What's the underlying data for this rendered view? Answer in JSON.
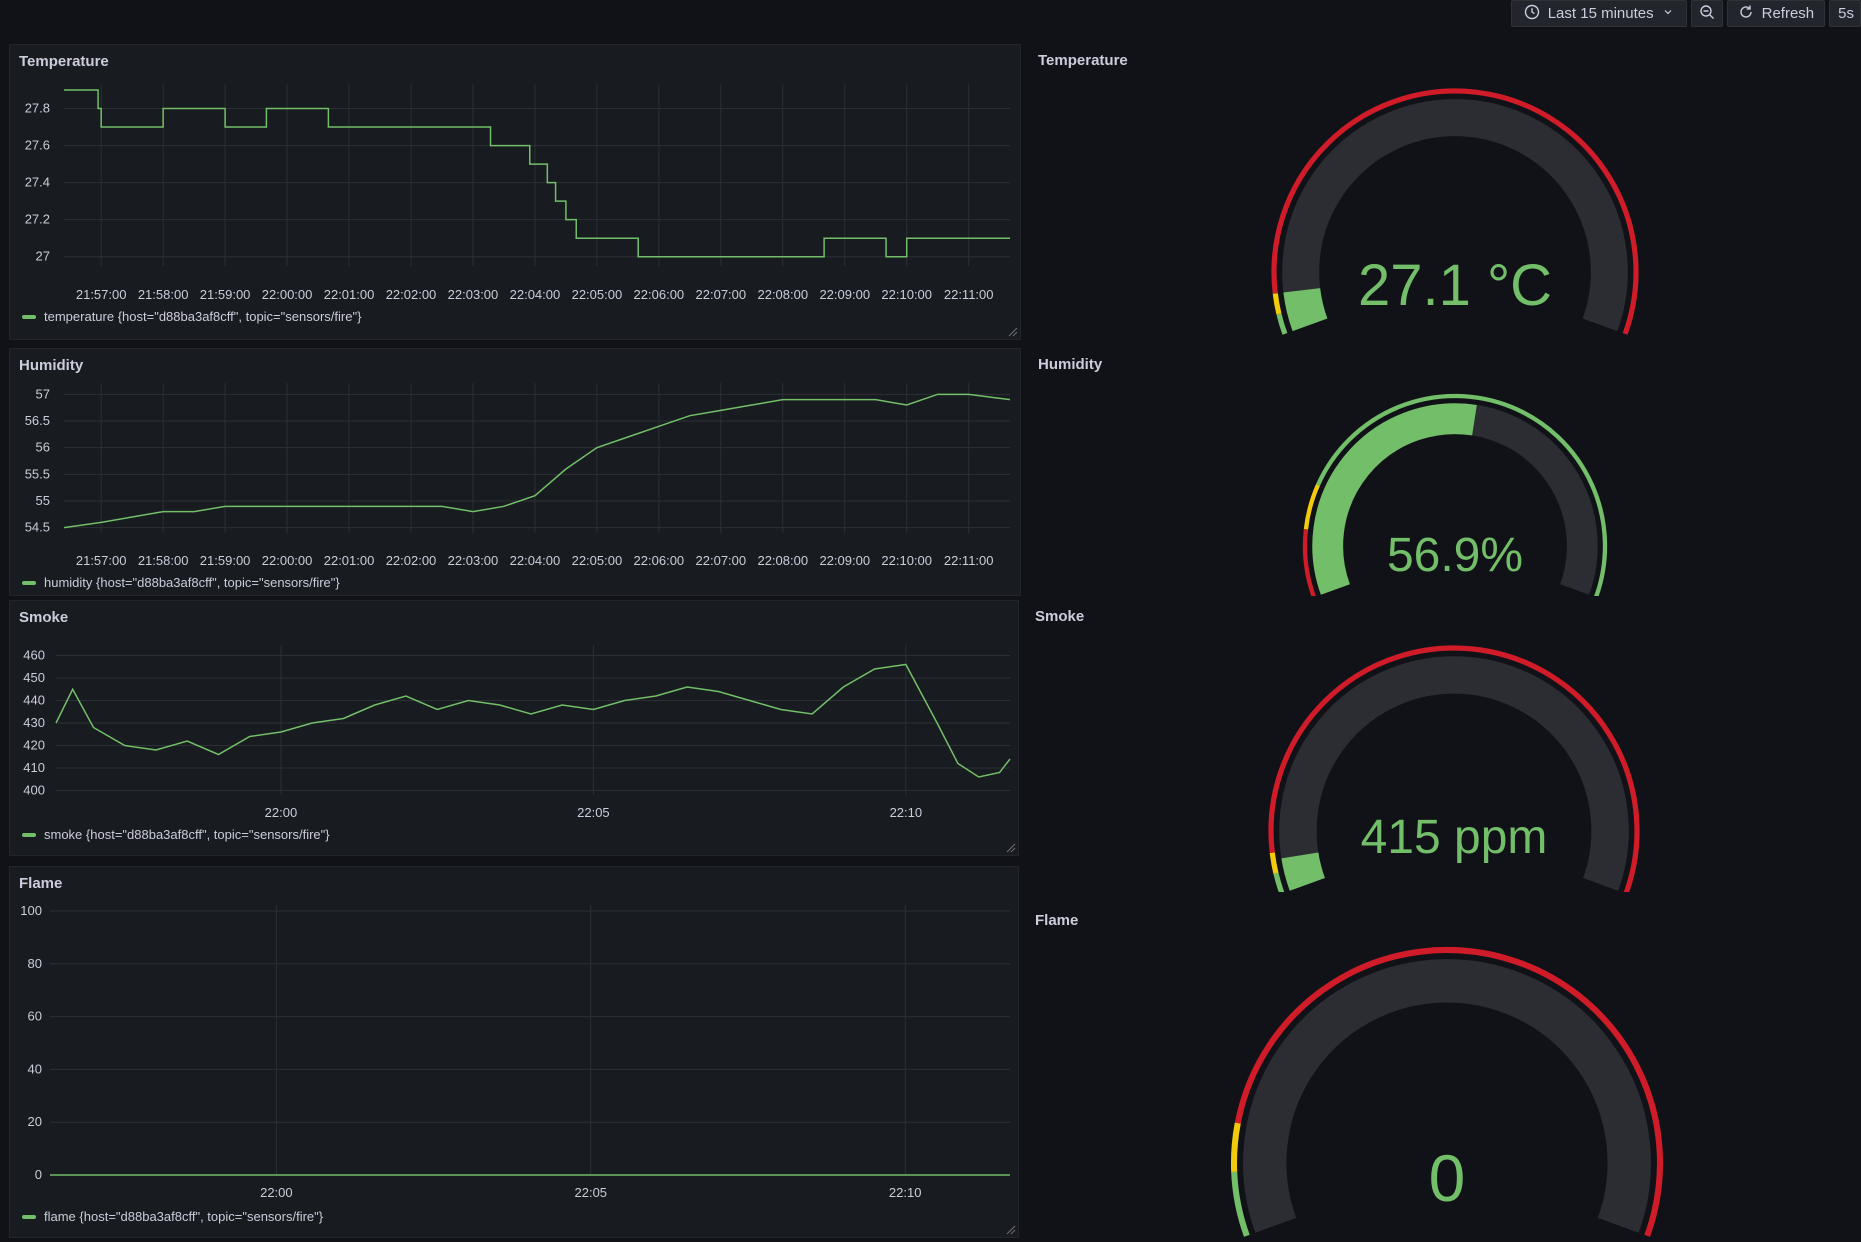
{
  "toolbar": {
    "time_range_label": "Last 15 minutes",
    "refresh_label": "Refresh",
    "refresh_interval": "5s",
    "icons": [
      "clock-icon",
      "chevron-down-icon",
      "zoom-out-icon",
      "refresh-icon"
    ]
  },
  "colors": {
    "series": "#73bf69",
    "threshold_red": "#d01c29",
    "threshold_yellow": "#f2cc0c",
    "threshold_green": "#73bf69",
    "gauge_track": "#2b2d33",
    "background": "#111217",
    "panel": "#181b1f"
  },
  "panels": {
    "temperature": {
      "title": "Temperature",
      "legend": "temperature {host=\"d88ba3af8cff\", topic=\"sensors/fire\"}"
    },
    "humidity": {
      "title": "Humidity",
      "legend": "humidity {host=\"d88ba3af8cff\", topic=\"sensors/fire\"}"
    },
    "smoke": {
      "title": "Smoke",
      "legend": "smoke {host=\"d88ba3af8cff\", topic=\"sensors/fire\"}"
    },
    "flame": {
      "title": "Flame",
      "legend": "flame {host=\"d88ba3af8cff\", topic=\"sensors/fire\"}"
    }
  },
  "gauges": {
    "temperature": {
      "title": "Temperature",
      "display": "27.1 °C",
      "fill_fraction": 0.06
    },
    "humidity": {
      "title": "Humidity",
      "display": "56.9%",
      "fill_fraction": 0.54
    },
    "smoke": {
      "title": "Smoke",
      "display": "415 ppm",
      "fill_fraction": 0.05
    },
    "flame": {
      "title": "Flame",
      "display": "0",
      "fill_fraction": 0.0
    }
  },
  "chart_data": [
    {
      "id": "temperature",
      "type": "line",
      "title": "Temperature",
      "x_ticks": [
        "21:57:00",
        "21:58:00",
        "21:59:00",
        "22:00:00",
        "22:01:00",
        "22:02:00",
        "22:03:00",
        "22:04:00",
        "22:05:00",
        "22:06:00",
        "22:07:00",
        "22:08:00",
        "22:09:00",
        "22:10:00",
        "22:11:00"
      ],
      "x_range": [
        "21:56:24",
        "22:11:40"
      ],
      "y_ticks": [
        "27",
        "27.2",
        "27.4",
        "27.6",
        "27.8"
      ],
      "ylim": [
        26.95,
        27.9
      ],
      "grid": true,
      "legend_position": "bottom-left",
      "series": [
        {
          "name": "temperature {host=\"d88ba3af8cff\", topic=\"sensors/fire\"}",
          "step": true,
          "x": [
            "21:56:24",
            "21:56:57",
            "21:57:00",
            "21:57:35",
            "21:58:00",
            "21:58:36",
            "21:59:00",
            "21:59:40",
            "22:00:00",
            "22:00:40",
            "22:01:00",
            "22:01:52",
            "22:02:00",
            "22:02:40",
            "22:03:00",
            "22:03:17",
            "22:03:40",
            "22:03:55",
            "22:04:12",
            "22:04:20",
            "22:04:30",
            "22:04:40",
            "22:04:52",
            "22:05:00",
            "22:05:40",
            "22:06:00",
            "22:06:40",
            "22:07:00",
            "22:07:40",
            "22:08:00",
            "22:08:40",
            "22:09:00",
            "22:09:40",
            "22:10:00",
            "22:10:20",
            "22:11:40"
          ],
          "y": [
            27.9,
            27.8,
            27.7,
            27.7,
            27.8,
            27.8,
            27.7,
            27.8,
            27.8,
            27.7,
            27.7,
            27.7,
            27.7,
            27.7,
            27.7,
            27.6,
            27.6,
            27.5,
            27.4,
            27.3,
            27.2,
            27.1,
            27.1,
            27.1,
            27.0,
            27.0,
            27.0,
            27.0,
            27.0,
            27.0,
            27.1,
            27.1,
            27.0,
            27.1,
            27.1,
            27.1
          ]
        }
      ]
    },
    {
      "id": "humidity",
      "type": "line",
      "title": "Humidity",
      "x_ticks": [
        "21:57:00",
        "21:58:00",
        "21:59:00",
        "22:00:00",
        "22:01:00",
        "22:02:00",
        "22:03:00",
        "22:04:00",
        "22:05:00",
        "22:06:00",
        "22:07:00",
        "22:08:00",
        "22:09:00",
        "22:10:00",
        "22:11:00"
      ],
      "x_range": [
        "21:56:24",
        "22:11:40"
      ],
      "y_ticks": [
        "54.5",
        "55",
        "55.5",
        "56",
        "56.5",
        "57"
      ],
      "ylim": [
        54.4,
        57.1
      ],
      "grid": true,
      "legend_position": "bottom-left",
      "series": [
        {
          "name": "humidity {host=\"d88ba3af8cff\", topic=\"sensors/fire\"}",
          "x": [
            "21:56:24",
            "21:57:00",
            "21:57:30",
            "21:58:00",
            "21:58:30",
            "21:59:00",
            "21:59:30",
            "22:00:00",
            "22:00:30",
            "22:01:00",
            "22:01:30",
            "22:02:00",
            "22:02:30",
            "22:03:00",
            "22:03:30",
            "22:04:00",
            "22:04:30",
            "22:05:00",
            "22:05:30",
            "22:06:00",
            "22:06:30",
            "22:07:00",
            "22:07:30",
            "22:08:00",
            "22:08:30",
            "22:09:00",
            "22:09:30",
            "22:10:00",
            "22:10:30",
            "22:11:00",
            "22:11:40"
          ],
          "y": [
            54.5,
            54.6,
            54.7,
            54.8,
            54.8,
            54.9,
            54.9,
            54.9,
            54.9,
            54.9,
            54.9,
            54.9,
            54.9,
            54.8,
            54.9,
            55.1,
            55.6,
            56.0,
            56.2,
            56.4,
            56.6,
            56.7,
            56.8,
            56.9,
            56.9,
            56.9,
            56.9,
            56.8,
            57.0,
            57.0,
            56.9
          ]
        }
      ]
    },
    {
      "id": "smoke",
      "type": "line",
      "title": "Smoke",
      "x_ticks": [
        "22:00",
        "22:05",
        "22:10"
      ],
      "x_range": [
        "21:56:24",
        "22:11:40"
      ],
      "y_ticks": [
        "400",
        "410",
        "420",
        "430",
        "440",
        "450",
        "460"
      ],
      "ylim": [
        398,
        462
      ],
      "grid": true,
      "legend_position": "bottom-left",
      "series": [
        {
          "name": "smoke {host=\"d88ba3af8cff\", topic=\"sensors/fire\"}",
          "x": [
            "21:56:24",
            "21:56:40",
            "21:57:00",
            "21:57:30",
            "21:58:00",
            "21:58:30",
            "21:59:00",
            "21:59:30",
            "22:00:00",
            "22:00:30",
            "22:01:00",
            "22:01:30",
            "22:02:00",
            "22:02:30",
            "22:03:00",
            "22:03:30",
            "22:04:00",
            "22:04:30",
            "22:05:00",
            "22:05:30",
            "22:06:00",
            "22:06:30",
            "22:07:00",
            "22:07:30",
            "22:08:00",
            "22:08:30",
            "22:09:00",
            "22:09:30",
            "22:10:00",
            "22:10:30",
            "22:10:50",
            "22:11:10",
            "22:11:30",
            "22:11:40"
          ],
          "y": [
            430,
            445,
            428,
            420,
            418,
            422,
            416,
            424,
            426,
            430,
            432,
            438,
            442,
            436,
            440,
            438,
            434,
            438,
            436,
            440,
            442,
            446,
            444,
            440,
            436,
            434,
            446,
            454,
            456,
            430,
            412,
            406,
            408,
            414
          ]
        }
      ]
    },
    {
      "id": "flame",
      "type": "line",
      "title": "Flame",
      "x_ticks": [
        "22:00",
        "22:05",
        "22:10"
      ],
      "x_range": [
        "21:56:24",
        "22:11:40"
      ],
      "y_ticks": [
        "0",
        "20",
        "40",
        "60",
        "80",
        "100"
      ],
      "ylim": [
        0,
        100
      ],
      "grid": true,
      "legend_position": "bottom-left",
      "series": [
        {
          "name": "flame {host=\"d88ba3af8cff\", topic=\"sensors/fire\"}",
          "x": [
            "21:56:24",
            "22:11:40"
          ],
          "y": [
            0,
            0
          ]
        }
      ]
    }
  ]
}
